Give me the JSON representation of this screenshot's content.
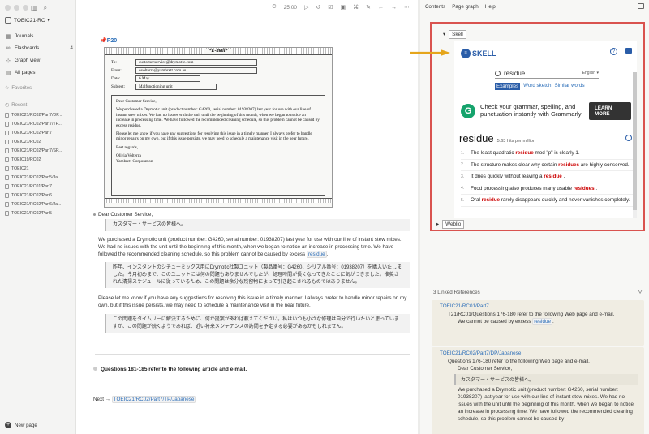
{
  "sidebar": {
    "graph_name": "TOEIC21-RC",
    "nav": [
      {
        "icon": "calendar-icon",
        "glyph": "▦",
        "label": "Journals",
        "count": ""
      },
      {
        "icon": "flashcards-icon",
        "glyph": "∞",
        "label": "Flashcards",
        "count": "4"
      },
      {
        "icon": "graph-icon",
        "glyph": "⊹",
        "label": "Graph view",
        "count": ""
      },
      {
        "icon": "pages-icon",
        "glyph": "▤",
        "label": "All pages",
        "count": ""
      }
    ],
    "favorites_label": "Favorites",
    "recent_label": "Recent",
    "recent": [
      "TOEIC21/RC02/Part7/DP...",
      "TOEIC21/RC02/Part7/TP...",
      "TOEIC21/RC02/Part7",
      "TOEIC21/RC02",
      "TOEIC21/RC02/Part7/SP...",
      "TOEIC19/RC02",
      "TOEIC21",
      "TOEIC21/RC02/Part5/Ja...",
      "TOEIC21/RC01/Part7",
      "TOEIC21/RC02/Part6",
      "TOEIC21/RC02/Part6/Ja...",
      "TOEIC21/RC02/Part5"
    ],
    "new_page": "New page"
  },
  "topbar": {
    "timer": "25:00",
    "icons": [
      "timer-icon",
      "play-icon",
      "undo-icon",
      "checkbox-icon",
      "image-icon",
      "translate-icon",
      "edit-icon",
      "back-icon",
      "forward-icon",
      "menu-icon"
    ]
  },
  "main": {
    "p20_label": "P20",
    "email": {
      "title": "*E-mail*",
      "to_label": "To:",
      "to": "customerservice@drymotic.com",
      "from_label": "From:",
      "from": "ovolterra@yambrett.com.au",
      "date_label": "Date:",
      "date": "6 May",
      "subject_label": "Subject:",
      "subject": "Malfunctioning unit",
      "greeting": "Dear Customer Service,",
      "p1": "We purchased a Drymotic unit (product number: G4260, serial number: 01938207) last year for use with our line of instant stew mixes. We had no issues with the unit until the beginning of this month, when we began to notice an increase in processing time. We have followed the recommended cleaning schedule, so this problem cannot be caused by excess residue.",
      "p2": "Please let me know if you have any suggestions for resolving this issue in a timely manner. I always prefer to handle minor repairs on my own, but if this issue persists, we may need to schedule a maintenance visit in the near future.",
      "closing": "Best regards,",
      "name": "Olivia Volterra",
      "company": "Yambrett Corporation"
    },
    "greeting": "Dear Customer Service,",
    "greeting_jp": "カスタマー・サービスの皆様へ。",
    "para1_a": "We purchased a Drymotic unit (product number: G4260, serial number: 01938207) last year for use with our line of instant stew mixes. We had no issues with the unit until the beginning of this month, when we began to notice an increase in processing time. We have followed the recommended cleaning schedule, so this problem cannot be caused by excess",
    "para1_ref": "residue",
    "para1_end": ".",
    "para1_jp": "昨年、インスタントのシチューミックス用にDrymotic社製ユニット（製品番号：G4260、シリアル番号：01938207）を購入いたしました。今月初めまで、このユニットには何の問題もありませんでしたが、処理時間が長くなってきたことに気がつきました。推奨された清掃スケジュールに従っているため、この問題は余分な残留物によって引き起こされるものではありません。",
    "para2": "Please let me know if you have any suggestions for resolving this issue in a timely manner. I always prefer to handle minor repairs on my own, but if this issue persists, we may need to schedule a maintenance visit in the near future.",
    "para2_jp": "この問題をタイムリーに解決するために、何か提案があれば教えてください。私はいつも小さな修理は自分で行いたいと思っていますが、この問題が続くようであれば、近い将来メンテナンスの訪問を予定する必要があるかもしれません。",
    "q181": "Questions 181-185 refer to the following article and e-mail.",
    "next_label": "Next →",
    "next_ref": "TOEIC21/RC02/Part7/TP/Japanese"
  },
  "right": {
    "tabs": [
      "Contents",
      "Page graph",
      "Help"
    ],
    "skell_tab": "Skell",
    "weblio_tab": "Weblio",
    "skell": {
      "logo": "SKELL",
      "query": "residue",
      "lang": "English",
      "tabs": [
        "Examples",
        "Word sketch",
        "Similar words"
      ],
      "ad_text": "Check your grammar, spelling, and punctuation instantly with Grammarly",
      "ad_button": "LEARN MORE",
      "word": "residue",
      "freq": "5.63 hits per million",
      "examples": [
        {
          "n": "1.",
          "a": "The least quadratic ",
          "h": "residue",
          "b": " mod \"p\" is clearly 1."
        },
        {
          "n": "2.",
          "a": "The structure makes clear why certain ",
          "h": "residues",
          "b": " are highly conserved."
        },
        {
          "n": "3.",
          "a": "It dries quickly without leaving a ",
          "h": "residue",
          "b": " ."
        },
        {
          "n": "4.",
          "a": "Food processing also produces many usable ",
          "h": "residues",
          "b": " ."
        },
        {
          "n": "5.",
          "a": "Oral ",
          "h": "residue",
          "b": " rarely disappears quickly and never vanishes completely."
        }
      ]
    },
    "linked_header": "3 Linked References",
    "ref1": {
      "title": "TOEIC21/RC01/Part7",
      "line": "T21/RC01/Questions 176-180 refer to the following Web page and e-mail.",
      "sub_a": "We cannot be caused by excess",
      "sub_ref": "residue",
      "sub_end": "."
    },
    "ref2": {
      "title": "TOEIC21/RC02/Part7/DP/Japanese",
      "line": "Questions 176-180 refer to the following Web page and e-mail.",
      "sub1": "Dear Customer Service,",
      "quote": "カスタマー・サービスの皆様へ。",
      "sub2": "We purchased a Drymotic unit (product number: G4260, serial number: 01938207) last year for use with our line of instant stew mixes. We had no issues with the unit until the beginning of this month, when we began to notice an increase in processing time. We have followed the recommended cleaning schedule, so this problem cannot be caused by"
    }
  }
}
